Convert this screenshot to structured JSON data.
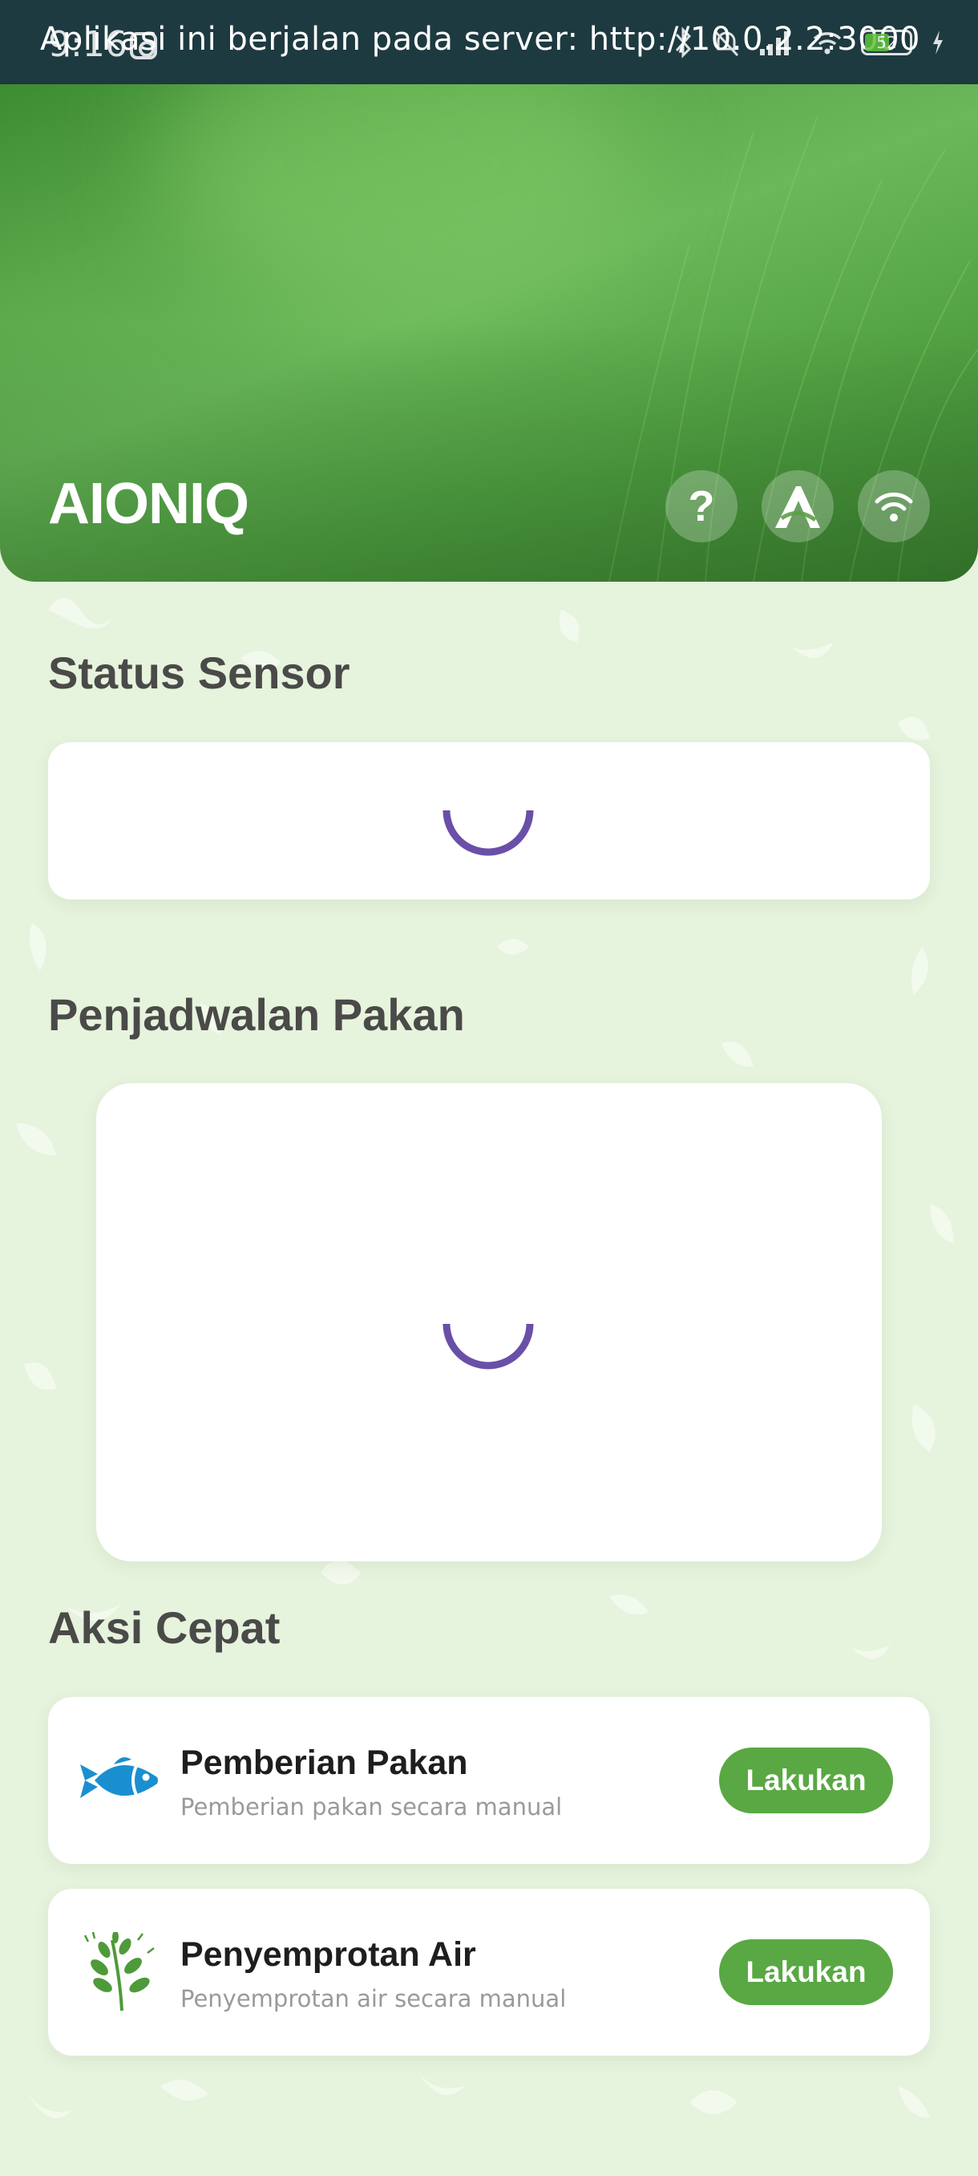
{
  "status_bar": {
    "time": "9:16",
    "banner": "Aplikasi ini berjalan pada server: http://10.0.2.2:3000",
    "battery": "52"
  },
  "header": {
    "title": "AIONIQ",
    "icons": [
      "help-icon",
      "logo-a-icon",
      "wifi-icon"
    ]
  },
  "status_sensor": {
    "title": "Status Sensor",
    "loading": true
  },
  "schedule": {
    "title": "Penjadwalan Pakan",
    "loading": true
  },
  "quick_actions": {
    "title": "Aksi Cepat",
    "items": [
      {
        "icon": "fish-icon",
        "title": "Pemberian Pakan",
        "subtitle": "Pemberian pakan secara manual",
        "button": "Lakukan"
      },
      {
        "icon": "plant-icon",
        "title": "Penyemprotan Air",
        "subtitle": "Penyemprotan air secara manual",
        "button": "Lakukan"
      }
    ]
  },
  "colors": {
    "accent_green": "#59a843",
    "spinner": "#6a4fa8",
    "status_bar": "#1d3a40",
    "fish_blue": "#1a8fd0"
  }
}
